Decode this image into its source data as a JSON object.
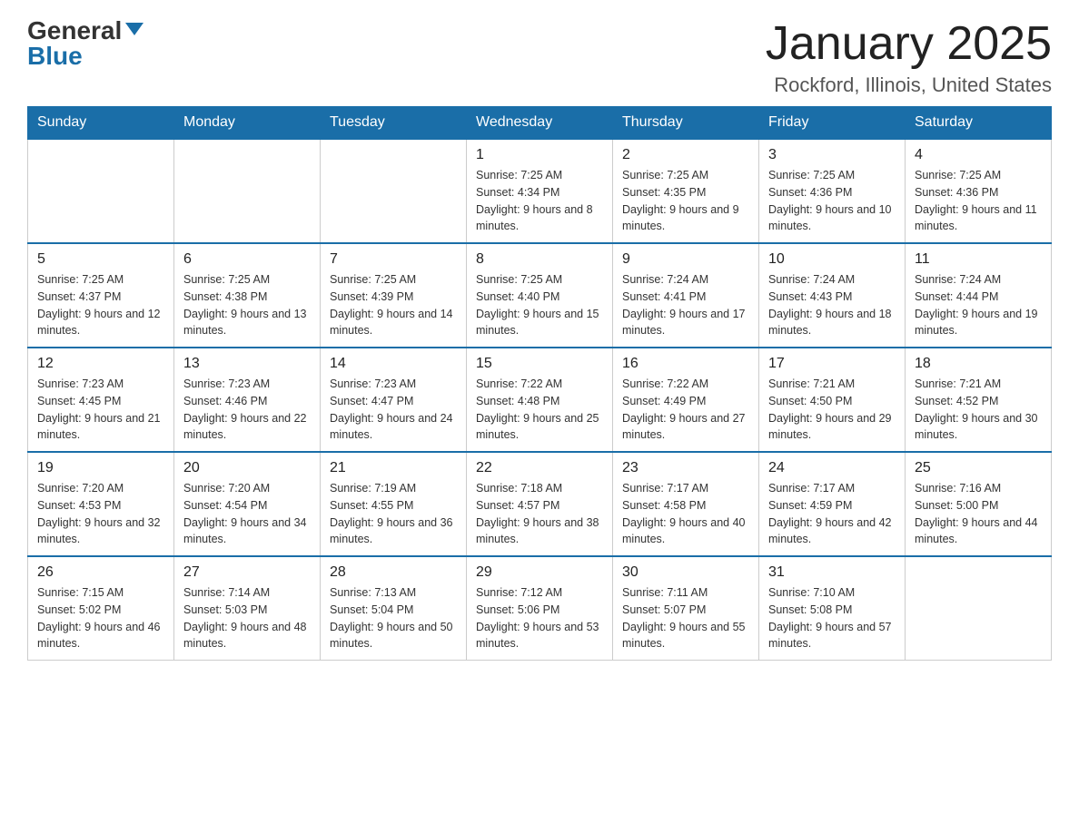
{
  "logo": {
    "general": "General",
    "blue": "Blue"
  },
  "title": "January 2025",
  "location": "Rockford, Illinois, United States",
  "days_of_week": [
    "Sunday",
    "Monday",
    "Tuesday",
    "Wednesday",
    "Thursday",
    "Friday",
    "Saturday"
  ],
  "weeks": [
    [
      {
        "day": "",
        "info": ""
      },
      {
        "day": "",
        "info": ""
      },
      {
        "day": "",
        "info": ""
      },
      {
        "day": "1",
        "info": "Sunrise: 7:25 AM\nSunset: 4:34 PM\nDaylight: 9 hours and 8 minutes."
      },
      {
        "day": "2",
        "info": "Sunrise: 7:25 AM\nSunset: 4:35 PM\nDaylight: 9 hours and 9 minutes."
      },
      {
        "day": "3",
        "info": "Sunrise: 7:25 AM\nSunset: 4:36 PM\nDaylight: 9 hours and 10 minutes."
      },
      {
        "day": "4",
        "info": "Sunrise: 7:25 AM\nSunset: 4:36 PM\nDaylight: 9 hours and 11 minutes."
      }
    ],
    [
      {
        "day": "5",
        "info": "Sunrise: 7:25 AM\nSunset: 4:37 PM\nDaylight: 9 hours and 12 minutes."
      },
      {
        "day": "6",
        "info": "Sunrise: 7:25 AM\nSunset: 4:38 PM\nDaylight: 9 hours and 13 minutes."
      },
      {
        "day": "7",
        "info": "Sunrise: 7:25 AM\nSunset: 4:39 PM\nDaylight: 9 hours and 14 minutes."
      },
      {
        "day": "8",
        "info": "Sunrise: 7:25 AM\nSunset: 4:40 PM\nDaylight: 9 hours and 15 minutes."
      },
      {
        "day": "9",
        "info": "Sunrise: 7:24 AM\nSunset: 4:41 PM\nDaylight: 9 hours and 17 minutes."
      },
      {
        "day": "10",
        "info": "Sunrise: 7:24 AM\nSunset: 4:43 PM\nDaylight: 9 hours and 18 minutes."
      },
      {
        "day": "11",
        "info": "Sunrise: 7:24 AM\nSunset: 4:44 PM\nDaylight: 9 hours and 19 minutes."
      }
    ],
    [
      {
        "day": "12",
        "info": "Sunrise: 7:23 AM\nSunset: 4:45 PM\nDaylight: 9 hours and 21 minutes."
      },
      {
        "day": "13",
        "info": "Sunrise: 7:23 AM\nSunset: 4:46 PM\nDaylight: 9 hours and 22 minutes."
      },
      {
        "day": "14",
        "info": "Sunrise: 7:23 AM\nSunset: 4:47 PM\nDaylight: 9 hours and 24 minutes."
      },
      {
        "day": "15",
        "info": "Sunrise: 7:22 AM\nSunset: 4:48 PM\nDaylight: 9 hours and 25 minutes."
      },
      {
        "day": "16",
        "info": "Sunrise: 7:22 AM\nSunset: 4:49 PM\nDaylight: 9 hours and 27 minutes."
      },
      {
        "day": "17",
        "info": "Sunrise: 7:21 AM\nSunset: 4:50 PM\nDaylight: 9 hours and 29 minutes."
      },
      {
        "day": "18",
        "info": "Sunrise: 7:21 AM\nSunset: 4:52 PM\nDaylight: 9 hours and 30 minutes."
      }
    ],
    [
      {
        "day": "19",
        "info": "Sunrise: 7:20 AM\nSunset: 4:53 PM\nDaylight: 9 hours and 32 minutes."
      },
      {
        "day": "20",
        "info": "Sunrise: 7:20 AM\nSunset: 4:54 PM\nDaylight: 9 hours and 34 minutes."
      },
      {
        "day": "21",
        "info": "Sunrise: 7:19 AM\nSunset: 4:55 PM\nDaylight: 9 hours and 36 minutes."
      },
      {
        "day": "22",
        "info": "Sunrise: 7:18 AM\nSunset: 4:57 PM\nDaylight: 9 hours and 38 minutes."
      },
      {
        "day": "23",
        "info": "Sunrise: 7:17 AM\nSunset: 4:58 PM\nDaylight: 9 hours and 40 minutes."
      },
      {
        "day": "24",
        "info": "Sunrise: 7:17 AM\nSunset: 4:59 PM\nDaylight: 9 hours and 42 minutes."
      },
      {
        "day": "25",
        "info": "Sunrise: 7:16 AM\nSunset: 5:00 PM\nDaylight: 9 hours and 44 minutes."
      }
    ],
    [
      {
        "day": "26",
        "info": "Sunrise: 7:15 AM\nSunset: 5:02 PM\nDaylight: 9 hours and 46 minutes."
      },
      {
        "day": "27",
        "info": "Sunrise: 7:14 AM\nSunset: 5:03 PM\nDaylight: 9 hours and 48 minutes."
      },
      {
        "day": "28",
        "info": "Sunrise: 7:13 AM\nSunset: 5:04 PM\nDaylight: 9 hours and 50 minutes."
      },
      {
        "day": "29",
        "info": "Sunrise: 7:12 AM\nSunset: 5:06 PM\nDaylight: 9 hours and 53 minutes."
      },
      {
        "day": "30",
        "info": "Sunrise: 7:11 AM\nSunset: 5:07 PM\nDaylight: 9 hours and 55 minutes."
      },
      {
        "day": "31",
        "info": "Sunrise: 7:10 AM\nSunset: 5:08 PM\nDaylight: 9 hours and 57 minutes."
      },
      {
        "day": "",
        "info": ""
      }
    ]
  ]
}
